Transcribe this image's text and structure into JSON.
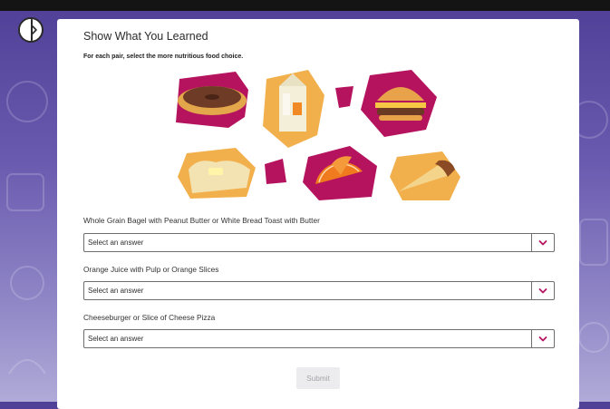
{
  "lesson": {
    "title": "Show What You Learned",
    "instructions": "For each pair, select the more nutritious food choice."
  },
  "questions": [
    {
      "label": "Whole Grain Bagel with Peanut Butter or White Bread Toast with Butter",
      "selected": "Select an answer"
    },
    {
      "label": "Orange Juice with Pulp or Orange Slices",
      "selected": "Select an answer"
    },
    {
      "label": "Cheeseburger or Slice of Cheese Pizza",
      "selected": "Select an answer"
    }
  ],
  "actions": {
    "submit_label": "Submit"
  },
  "icons": {
    "nav_toggle": "chevron-right-icon",
    "select_chevron": "chevron-down-icon"
  },
  "colors": {
    "accent": "#b5135e",
    "tile_orange": "#f2b04d",
    "background_top": "#4f3f96",
    "background_bottom": "#b0abd8"
  }
}
